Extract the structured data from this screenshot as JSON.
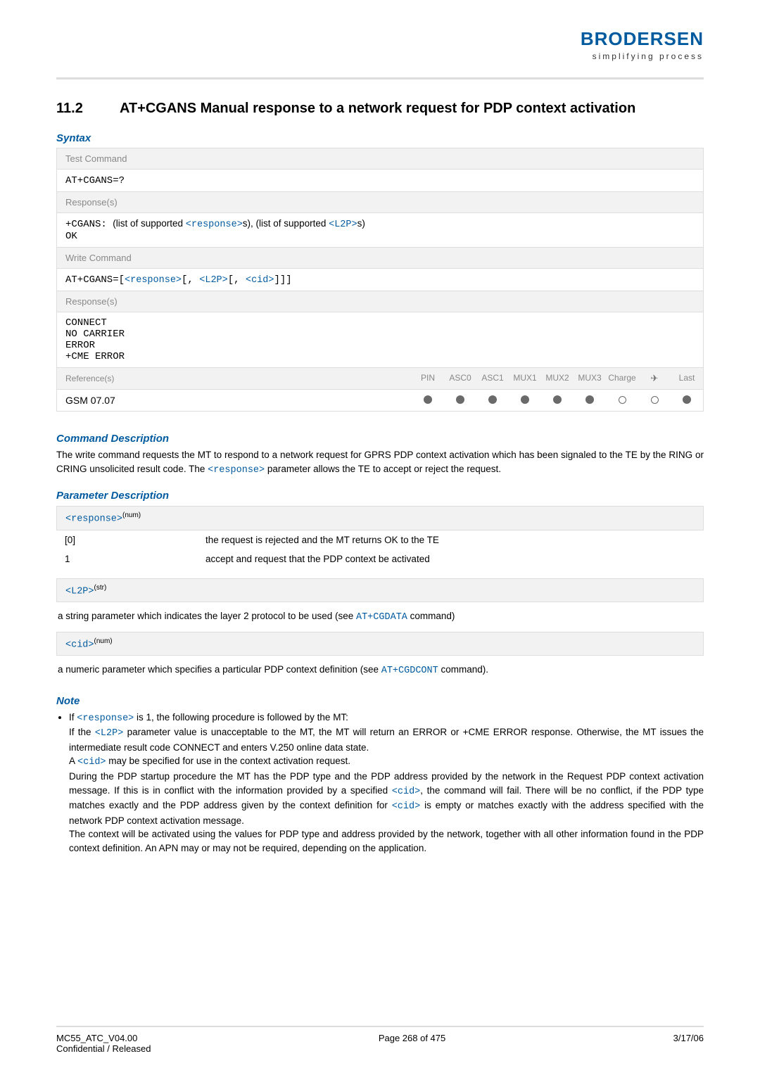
{
  "brand": {
    "name": "BRODERSEN",
    "tagline": "simplifying process"
  },
  "heading": {
    "number": "11.2",
    "title": "AT+CGANS   Manual response to a network request for PDP context activation"
  },
  "labels": {
    "syntax": "Syntax",
    "test_command": "Test Command",
    "write_command": "Write Command",
    "responses": "Response(s)",
    "references": "Reference(s)",
    "command_description": "Command Description",
    "parameter_description": "Parameter Description",
    "note": "Note"
  },
  "test_cmd": "AT+CGANS=?",
  "test_resp_prefix": "+CGANS: ",
  "test_resp_mid1": "(list of supported ",
  "test_resp_mid2": "s), (list of supported ",
  "test_resp_mid3": "s)",
  "ok": "OK",
  "write_cmd_prefix": "AT+CGANS=[",
  "write_cmd_sep1": "[, ",
  "write_cmd_sep2": "[, ",
  "write_cmd_suffix": "]]]",
  "write_resp_l1": "CONNECT",
  "write_resp_l2": "NO CARRIER",
  "write_resp_l3": "ERROR",
  "write_resp_l4": "+CME ERROR",
  "ref_cols": [
    "PIN",
    "ASC0",
    "ASC1",
    "MUX1",
    "MUX2",
    "MUX3",
    "Charge",
    "✈",
    "Last"
  ],
  "ref_name": "GSM 07.07",
  "ref_status": [
    "fill",
    "fill",
    "fill",
    "fill",
    "fill",
    "fill",
    "empty",
    "empty",
    "fill"
  ],
  "cmd_desc_p1": "The write command requests the MT to respond to a network request for GPRS PDP context activation which has been signaled to the TE by the RING or CRING unsolicited result code. The ",
  "cmd_desc_p2": " parameter allows the TE to accept or reject the request.",
  "params": {
    "response": {
      "name": "<response>",
      "type": "(num)"
    },
    "l2p": {
      "name": "<L2P>",
      "type": "(str)"
    },
    "cid": {
      "name": "<cid>",
      "type": "(num)"
    },
    "row0_key": "[0]",
    "row0_desc": "the request is rejected and the MT returns OK to the TE",
    "row1_key": "1",
    "row1_desc": "accept and request that the PDP context be activated",
    "l2p_desc_pre": "a string parameter which indicates the layer 2 protocol to be used (see ",
    "l2p_desc_link": "AT+CGDATA",
    "l2p_desc_post": " command)",
    "cid_desc_pre": "a numeric parameter which specifies a particular PDP context definition (see ",
    "cid_desc_link": "AT+CGDCONT",
    "cid_desc_post": " command)."
  },
  "note": {
    "l1a": "If ",
    "l1b": " is 1, the following procedure is followed by the MT:",
    "l2a": "If the ",
    "l2b": " parameter value is unacceptable to the MT, the MT will return an ERROR or +CME ERROR response. Otherwise, the MT issues the intermediate result code CONNECT and enters V.250 online data state.",
    "l3a": "A ",
    "l3b": " may be specified for use in the context activation request.",
    "l4a": "During the PDP startup procedure the MT has the PDP type and the PDP address provided by the network in the Request PDP context activation message. If this is in conflict with the information provided by a specified ",
    "l4b": ", the command will fail. There will be no conflict, if the PDP type matches exactly and the PDP address given by the context definition for ",
    "l4c": " is empty or matches exactly with the address specified with the network PDP context activation message.",
    "l5": "The context will be activated using the values for PDP type and address provided by the network, together with all other information found in the PDP context definition. An APN may or may not be required, depending on the application."
  },
  "footer": {
    "left1": "MC55_ATC_V04.00",
    "left2": "Confidential / Released",
    "center": "Page 268 of 475",
    "right": "3/17/06"
  }
}
